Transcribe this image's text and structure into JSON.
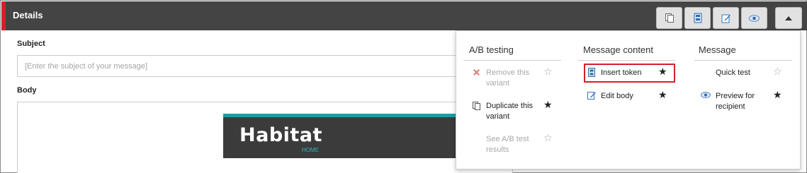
{
  "header": {
    "title": "Details",
    "colors": {
      "bar": "#444444",
      "accent": "#d3202b"
    },
    "buttons": [
      {
        "name": "copy-icon"
      },
      {
        "name": "insert-token-icon"
      },
      {
        "name": "edit-icon"
      },
      {
        "name": "eye-icon"
      },
      {
        "name": "caret-up-icon"
      }
    ]
  },
  "form": {
    "subject_label": "Subject",
    "subject_placeholder": "[Enter the subject of your message]",
    "body_label": "Body"
  },
  "preview": {
    "brand": "Habitat",
    "brand_sub": "HOME",
    "colors": {
      "banner": "#3b3b3b",
      "stripe": "#1e9ca6"
    }
  },
  "dropdown": {
    "columns": [
      {
        "heading": "A/B testing",
        "items": [
          {
            "label": "Remove this variant",
            "icon": "close-icon",
            "disabled": true,
            "starred": false
          },
          {
            "label": "Duplicate this variant",
            "icon": "copy-icon",
            "disabled": false,
            "starred": true
          },
          {
            "label": "See A/B test results",
            "icon": "",
            "disabled": true,
            "starred": false
          }
        ]
      },
      {
        "heading": "Message content",
        "items": [
          {
            "label": "Insert token",
            "icon": "insert-token-icon",
            "disabled": false,
            "starred": true,
            "highlighted": true
          },
          {
            "label": "Edit body",
            "icon": "edit-icon",
            "disabled": false,
            "starred": true
          }
        ]
      },
      {
        "heading": "Message",
        "items": [
          {
            "label": "Quick test",
            "icon": "",
            "disabled": false,
            "starred": false
          },
          {
            "label": "Preview for recipient",
            "icon": "eye-icon",
            "disabled": false,
            "starred": true
          }
        ]
      }
    ],
    "star_glyphs": {
      "empty": "☆",
      "full": "★"
    },
    "highlight_color": "#d3202b"
  }
}
